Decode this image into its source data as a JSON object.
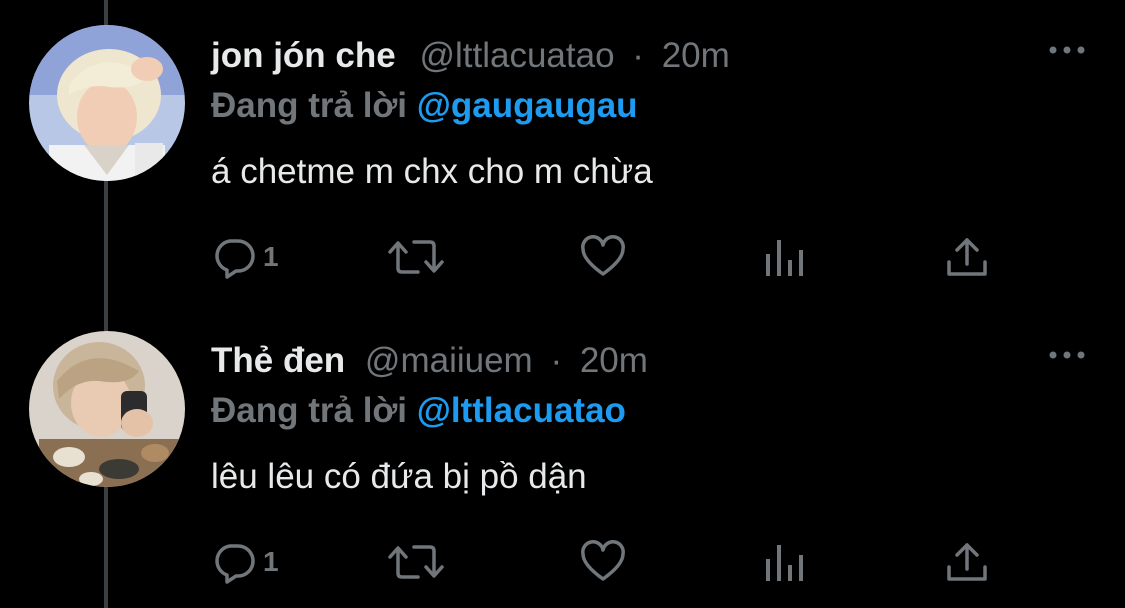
{
  "tweets": [
    {
      "display_name": "jon jón che",
      "handle": "@lttlacuatao",
      "separator": "·",
      "time": "20m",
      "replying_prefix": "Đang trả lời",
      "replying_to": "@gaugaugau",
      "text": "á chetme m chx cho m chừa",
      "reply_count": "1",
      "avatar_icon": "profile-photo-blonde"
    },
    {
      "display_name": "Thẻ đen",
      "handle": "@maiiuem",
      "separator": "·",
      "time": "20m",
      "replying_prefix": "Đang trả lời",
      "replying_to": "@lttlacuatao",
      "text": "lêu lêu có đứa bị pồ dận",
      "reply_count": "1",
      "avatar_icon": "profile-photo-camo"
    }
  ],
  "colors": {
    "background": "#000000",
    "text": "#e7e9ea",
    "muted": "#71767b",
    "accent": "#1d9bf0",
    "thread_line": "#3a3f44"
  }
}
